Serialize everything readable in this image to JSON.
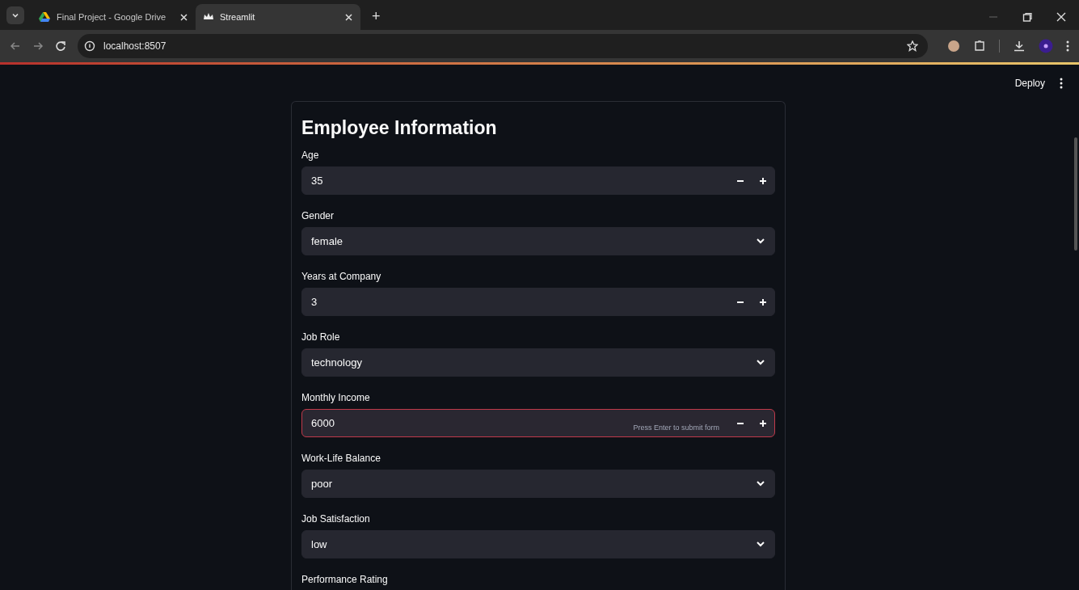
{
  "browser": {
    "tabs": [
      {
        "title": "Final Project - Google Drive",
        "kind": "drive",
        "selected": false
      },
      {
        "title": "Streamlit",
        "kind": "streamlit",
        "selected": true
      }
    ],
    "new_tab": "+",
    "address": "localhost:8507"
  },
  "app": {
    "deploy": "Deploy"
  },
  "form": {
    "title": "Employee Information",
    "fields": [
      {
        "label": "Age",
        "kind": "number",
        "value": "35",
        "focused": false
      },
      {
        "label": "Gender",
        "kind": "select",
        "value": "female",
        "focused": false
      },
      {
        "label": "Years at Company",
        "kind": "number",
        "value": "3",
        "focused": false
      },
      {
        "label": "Job Role",
        "kind": "select",
        "value": "technology",
        "focused": false
      },
      {
        "label": "Monthly Income",
        "kind": "number",
        "value": "6000",
        "focused": true,
        "hint": "Press Enter to submit form"
      },
      {
        "label": "Work-Life Balance",
        "kind": "select",
        "value": "poor",
        "focused": false
      },
      {
        "label": "Job Satisfaction",
        "kind": "select",
        "value": "low",
        "focused": false
      },
      {
        "label": "Performance Rating",
        "kind": "label_only"
      }
    ]
  }
}
